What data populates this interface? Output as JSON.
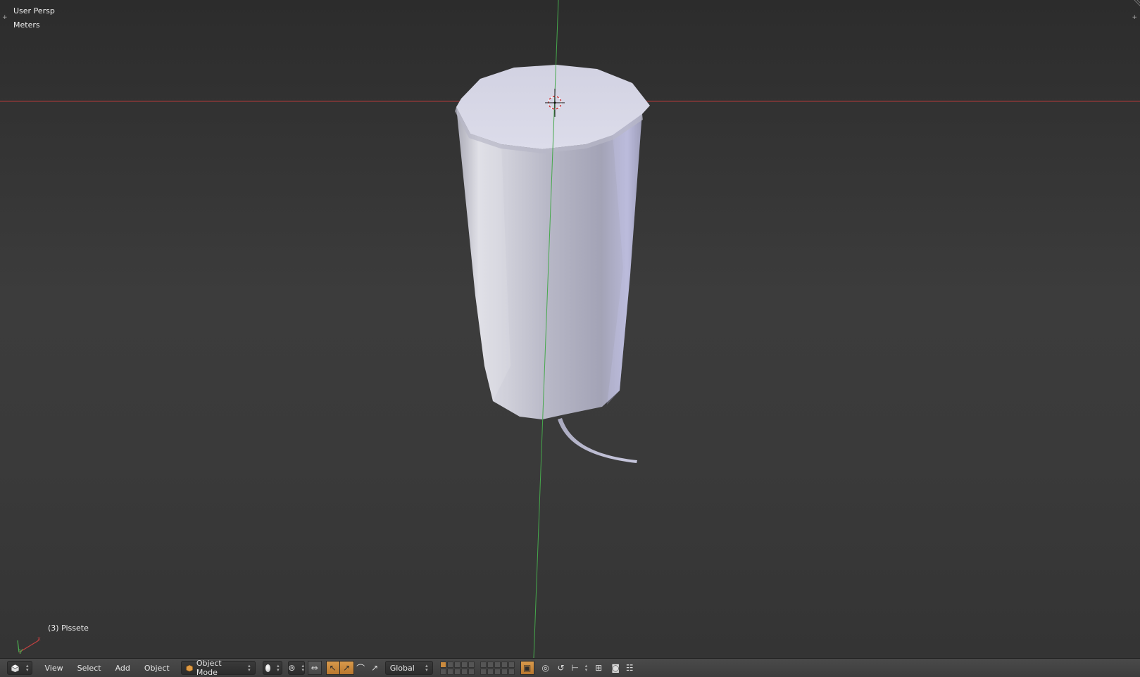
{
  "viewport": {
    "view_name": "User Persp",
    "units": "Meters",
    "object_info": "(3) Pissete",
    "axis_labels": {
      "x": "x",
      "y": "y"
    },
    "colors": {
      "x_axis": "#b53a3a",
      "y_axis": "#4caf50",
      "mesh_light": "#d6d6e6",
      "mesh_shadow": "#8a8a9a"
    }
  },
  "header": {
    "editor_icon": "cube-icon",
    "menus": {
      "view": "View",
      "select": "Select",
      "add": "Add",
      "object": "Object"
    },
    "mode": {
      "icon": "object-mode-icon",
      "label": "Object Mode"
    },
    "shading": {
      "icon": "solid-sphere-icon"
    },
    "pivot": {
      "icon": "pivot-icon"
    },
    "manipulator_icons": [
      "manipulator-toggle-icon",
      "translate-icon",
      "rotate-icon",
      "scale-icon"
    ],
    "orientation": {
      "label": "Global"
    },
    "layers": {
      "first_group_active": [
        1
      ],
      "second_group_active": []
    },
    "snap_icons": [
      "lock-camera-icon",
      "proportional-edit-icon",
      "snap-icon",
      "snap-element-icon",
      "snap-target-icon"
    ],
    "render_icons": [
      "render-still-icon",
      "render-animation-icon"
    ],
    "accent_color": "#d89a4c"
  }
}
